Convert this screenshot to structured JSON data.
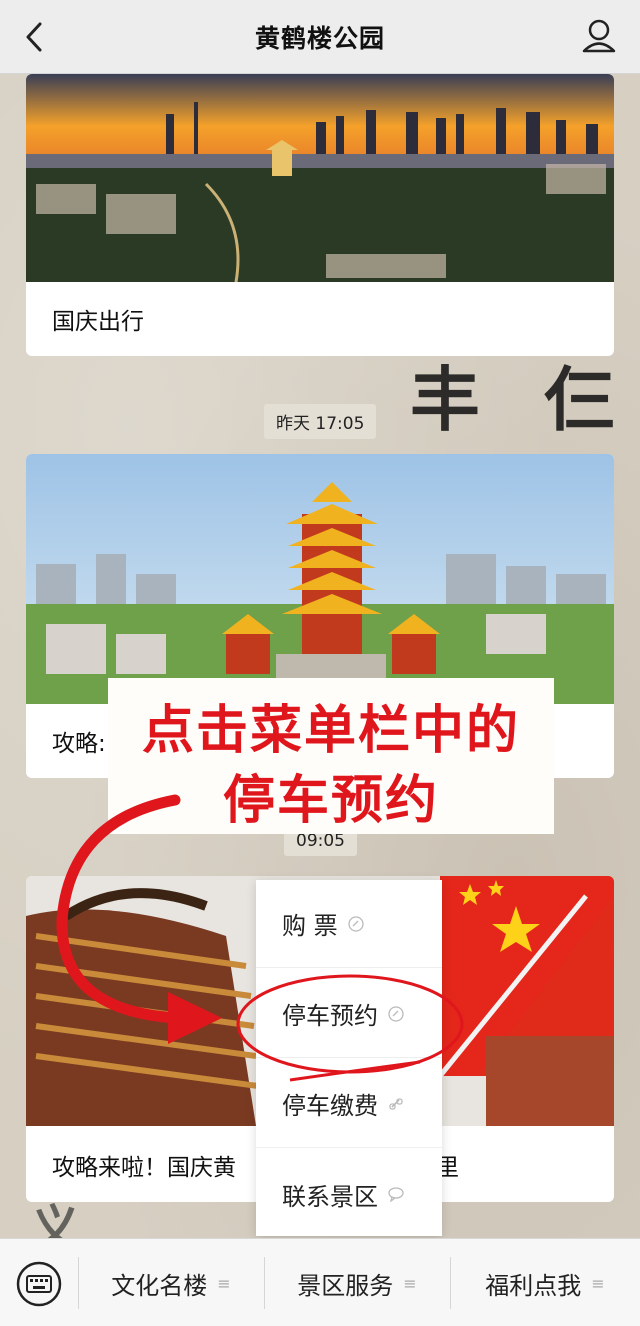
{
  "header": {
    "title": "黄鹤楼公园",
    "back_icon": "chevron-left-icon",
    "profile_icon": "user-icon"
  },
  "messages": {
    "card1": {
      "caption": "国庆出行"
    },
    "time1": "昨天 17:05",
    "card2": {
      "caption": "攻略:"
    },
    "time2": "09:05",
    "card3": {
      "caption": "攻略来啦！国庆黄",
      "caption_tail": "里"
    }
  },
  "annotation": {
    "line1": "点击菜单栏中的",
    "line2": "停车预约",
    "color": "#e0161d"
  },
  "popup_menu": {
    "items": [
      {
        "label": "购 票",
        "icon": "link-icon"
      },
      {
        "label": "停车预约",
        "icon": "link-icon"
      },
      {
        "label": "停车缴费",
        "icon": "link-icon"
      },
      {
        "label": "联系景区",
        "icon": "chat-bubble-icon"
      }
    ],
    "highlighted": "停车预约"
  },
  "bottom_menu": {
    "keyboard_icon": "keyboard-icon",
    "items": [
      {
        "label": "文化名楼"
      },
      {
        "label": "景区服务"
      },
      {
        "label": "福利点我"
      }
    ]
  },
  "colors": {
    "header_bg": "#ededed",
    "annotation_red": "#e0161d",
    "menubar_bg": "#f7f7f7"
  }
}
